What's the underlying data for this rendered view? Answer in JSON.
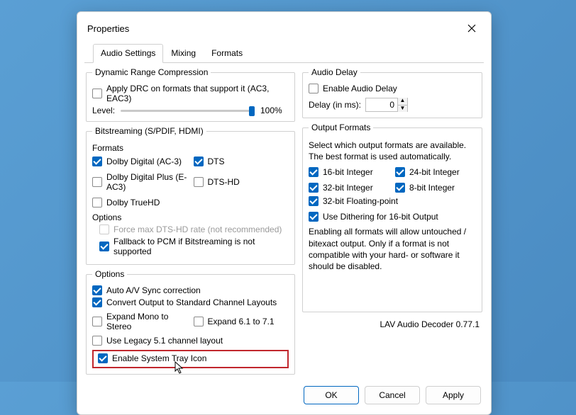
{
  "window": {
    "title": "Properties"
  },
  "tabs": {
    "t0": "Audio Settings",
    "t1": "Mixing",
    "t2": "Formats"
  },
  "drc": {
    "legend": "Dynamic Range Compression",
    "apply": "Apply DRC on formats that support it (AC3, EAC3)",
    "level_label": "Level:",
    "level_pct": "100%"
  },
  "bs": {
    "legend": "Bitstreaming (S/PDIF, HDMI)",
    "formats_hdr": "Formats",
    "dd": "Dolby Digital (AC-3)",
    "dts": "DTS",
    "ddp": "Dolby Digital Plus (E-AC3)",
    "dtshd": "DTS-HD",
    "truehd": "Dolby TrueHD",
    "options_hdr": "Options",
    "force": "Force max DTS-HD rate (not recommended)",
    "fallback": "Fallback to PCM if Bitstreaming is not supported"
  },
  "opts": {
    "legend": "Options",
    "autosync": "Auto A/V Sync correction",
    "convert": "Convert Output to Standard Channel Layouts",
    "mono": "Expand Mono to Stereo",
    "e61": "Expand 6.1 to 7.1",
    "legacy": "Use Legacy 5.1 channel layout",
    "tray": "Enable System Tray Icon"
  },
  "delay": {
    "legend": "Audio Delay",
    "enable": "Enable Audio Delay",
    "label": "Delay (in ms):",
    "value": "0"
  },
  "out": {
    "legend": "Output Formats",
    "hint1": "Select which output formats are available. The best format is used automatically.",
    "i16": "16-bit Integer",
    "i24": "24-bit Integer",
    "i32": "32-bit Integer",
    "i8": "8-bit Integer",
    "f32": "32-bit Floating-point",
    "dither": "Use Dithering for 16-bit Output",
    "hint2": "Enabling all formats will allow untouched / bitexact output. Only if a format is not compatible with your hard- or software it should be disabled."
  },
  "footer": {
    "decoder": "LAV Audio Decoder 0.77.1",
    "ok": "OK",
    "cancel": "Cancel",
    "apply": "Apply"
  }
}
